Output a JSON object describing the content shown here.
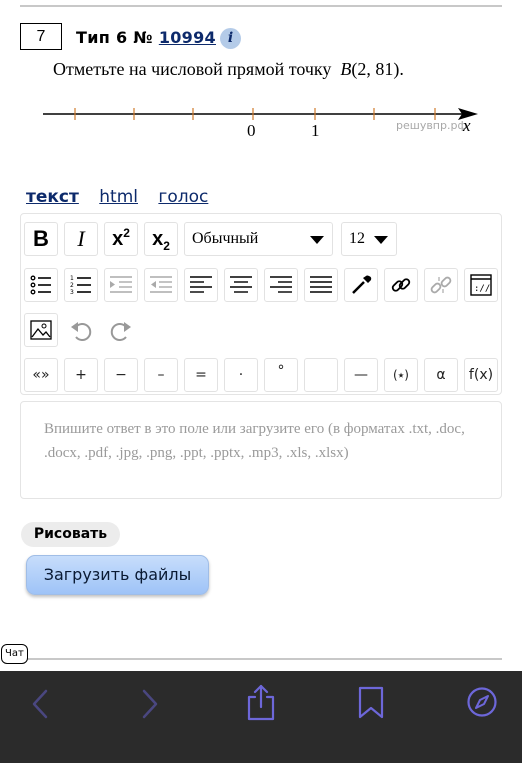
{
  "task": {
    "number": "7",
    "type_label": "Тип 6 №",
    "id_link": "10994",
    "info_icon": "info-icon"
  },
  "question": {
    "text": "Отметьте на числовой прямой точку",
    "math_var": "B",
    "math_value": "(2, 81)",
    "period": "."
  },
  "number_line": {
    "label_zero": "0",
    "label_one": "1",
    "axis_label": "x",
    "watermark": "решувпр.рф",
    "tick_color": "#d07a2a"
  },
  "tabs": [
    "текст",
    "html",
    "голос"
  ],
  "editor": {
    "bold": "B",
    "italic": "I",
    "superscript_base": "x",
    "superscript_exp": "2",
    "subscript_base": "x",
    "subscript_exp": "2",
    "style_select": "Обычный",
    "size_select": "12",
    "symbols": [
      "«»",
      "+",
      "−",
      "–",
      "=",
      "·",
      "°",
      "",
      "—",
      "(٭)",
      "α",
      "f(x)"
    ]
  },
  "answer": {
    "placeholder": "Впишите ответ в это поле или загрузите его (в форматах .txt, .doc, .docx, .pdf, .jpg, .png, .ppt, .pptx, .mp3, .xls, .xlsx)"
  },
  "buttons": {
    "draw": "Рисовать",
    "upload": "Загрузить файлы",
    "chat": "Чат"
  },
  "browser": {
    "icons": [
      "back-icon",
      "forward-icon",
      "share-icon",
      "bookmarks-icon",
      "compass-icon"
    ],
    "accent": "#6d67d9"
  }
}
